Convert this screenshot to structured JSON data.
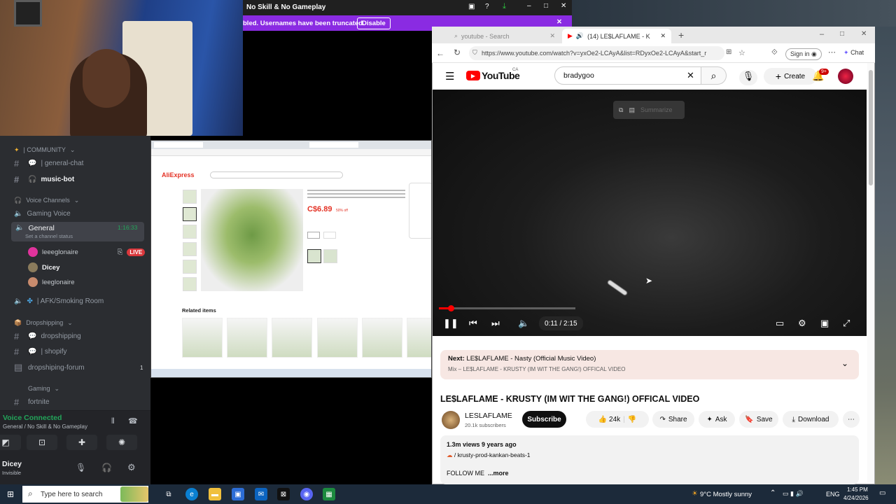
{
  "colors": {
    "youtube_red": "#ff0000",
    "discord_green": "#23a55a",
    "twitch_purple": "#8a2be2",
    "live_red": "#da373c"
  },
  "obs": {
    "window_title": "No Skill & No Gameplay",
    "banner_text": "bled. Usernames have been truncated.",
    "banner_button": "Disable"
  },
  "discord": {
    "community_category": "| COMMUNITY",
    "channels": [
      "| general-chat",
      "music-bot"
    ],
    "voice_category": "Voice Channels",
    "voice_channels": [
      "Gaming Voice",
      "General"
    ],
    "general_timer": "1:16:33",
    "channel_status_placeholder": "Set a channel status",
    "voice_users": [
      "leeeglonaire",
      "Dicey",
      "leeglonaire"
    ],
    "live_label": "LIVE",
    "afk_channel": "| AFK/Smoking Room",
    "dropshipping_category": "Dropshipping",
    "dropshipping_channels": [
      "dropshipping",
      "| shopify",
      "dropshiping-forum"
    ],
    "forum_count": "1",
    "gaming_category": "Gaming",
    "gaming_channel": "fortnite",
    "voice_connected": "Voice Connected",
    "voice_connected_sub": "General / No Skill & No Gameplay",
    "username": "Dicey",
    "user_status": "Invisible"
  },
  "aliexpress": {
    "logo": "AliExpress",
    "price": "C$6.89",
    "discount": "50% off",
    "related": "Related items"
  },
  "browser": {
    "tab1_label": "youtube - Search",
    "tab2_label": "(14) LE$LAFLAME - KRUSTY (I",
    "url": "https://www.youtube.com/watch?v=yxOe2-LCAyA&list=RDyxOe2-LCAyA&start_r",
    "signin": "Sign in",
    "chat": "Chat"
  },
  "youtube": {
    "logo": "YouTube",
    "region": "CA",
    "search_value": "bradygoo",
    "create": "Create",
    "notif_count": "9+",
    "summarize": "Summarize",
    "time": "0:11 / 2:15",
    "progress_fraction": 0.085,
    "next_label": "Next:",
    "next_title": "LE$LAFLAME - Nasty (Official Music Video)",
    "mix_label": "Mix – LE$LAFLAME - KRUSTY (IM WIT THE GANG!) OFFICAL VIDEO",
    "video_title": "LE$LAFLAME - KRUSTY (IM WIT THE GANG!) OFFICAL VIDEO",
    "channel": "LESLAFLAME",
    "subs": "20.1k subscribers",
    "subscribe": "Subscribe",
    "likes": "24k",
    "share": "Share",
    "ask": "Ask",
    "save": "Save",
    "download": "Download",
    "views": "1.3m views  9 years ago",
    "link": "/ krusty-prod-kankan-beats-1",
    "follow": "FOLLOW ME",
    "more": "...more"
  },
  "taskbar": {
    "search_placeholder": "Type here to search",
    "weather": "9°C  Mostly sunny",
    "lang": "ENG",
    "time": "1:45 PM",
    "date": "4/24/2026"
  }
}
